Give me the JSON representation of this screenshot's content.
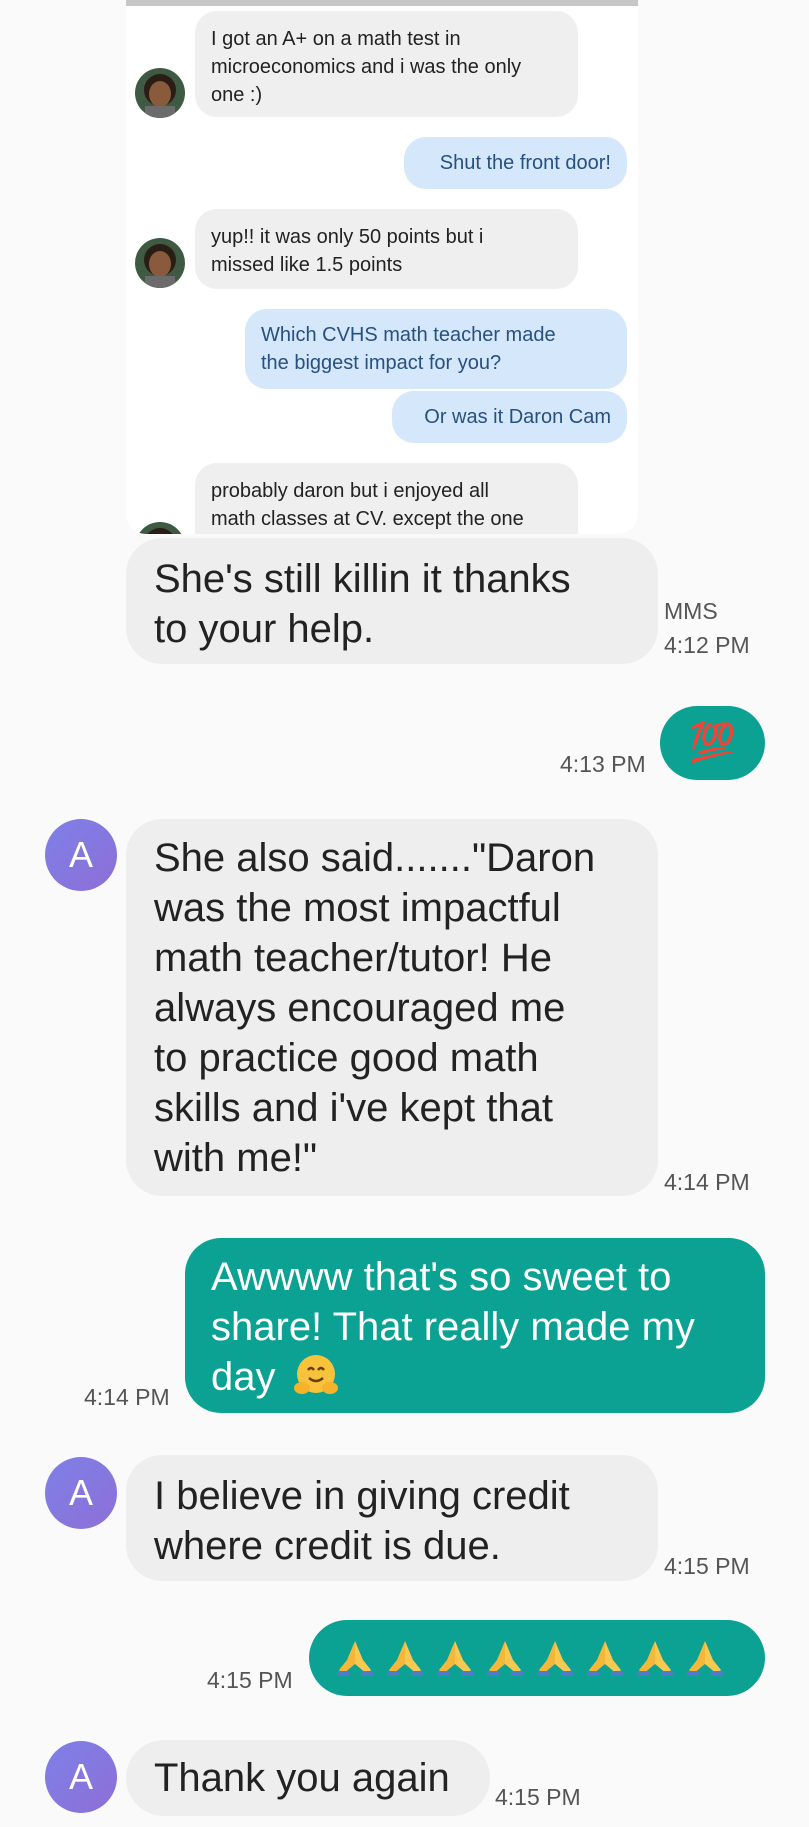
{
  "colors": {
    "incoming_bubble": "#eeeeee",
    "outgoing_bubble": "#0ba193",
    "avatar_gradient_start": "#7e80e8",
    "avatar_gradient_end": "#8d6fd6",
    "screenshot_outgoing_bubble": "#d5e7fb"
  },
  "screenshot": {
    "messages": [
      {
        "dir": "in",
        "lines": [
          "I got an A+ on a math test in",
          "microeconomics and i was the only",
          "one :)"
        ]
      },
      {
        "dir": "out",
        "lines": [
          "Shut the front door!"
        ]
      },
      {
        "dir": "in",
        "lines": [
          "yup!! it was only 50 points but i",
          "missed like 1.5 points"
        ]
      },
      {
        "dir": "out",
        "lines": [
          "Which CVHS math teacher made",
          "the biggest impact for you?"
        ]
      },
      {
        "dir": "out",
        "lines": [
          "Or was it Daron Cam"
        ]
      },
      {
        "dir": "in",
        "lines": [
          "probably daron but i enjoyed all",
          "math classes at CV. except the one"
        ]
      }
    ]
  },
  "conversation": {
    "m1": {
      "lines": [
        "She's still killin it thanks",
        "to your help."
      ],
      "tag": "MMS",
      "time": "4:12 PM"
    },
    "m2": {
      "emoji": "💯",
      "time": "4:13 PM"
    },
    "m3": {
      "avatar": "A",
      "lines": [
        "She also said.......\"Daron",
        "was the most impactful",
        "math teacher/tutor! He",
        "always encouraged me",
        "to practice good math",
        "skills and i've kept that",
        "with me!\""
      ],
      "time": "4:14 PM"
    },
    "m4": {
      "lines": [
        "Awwww that's so sweet to",
        "share! That really made my",
        "day"
      ],
      "emoji": "hugging-face-icon",
      "time": "4:14 PM"
    },
    "m5": {
      "avatar": "A",
      "lines": [
        "I believe in giving credit",
        "where credit is due."
      ],
      "time": "4:15 PM"
    },
    "m6": {
      "emoji_count": 8,
      "emoji": "folded-hands-icon",
      "time": "4:15 PM"
    },
    "m7": {
      "avatar": "A",
      "lines": [
        "Thank you again"
      ],
      "time": "4:15 PM"
    }
  }
}
